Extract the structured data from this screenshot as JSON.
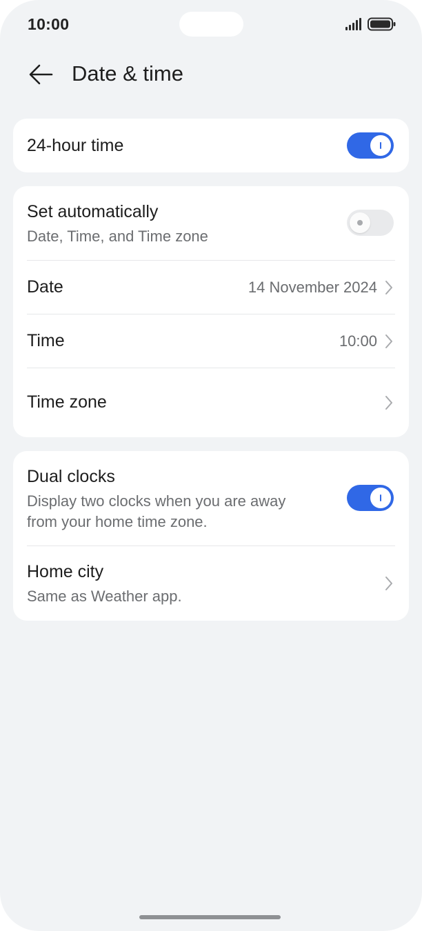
{
  "status_bar": {
    "time": "10:00",
    "icons": [
      "signal-icon",
      "battery-icon"
    ]
  },
  "header": {
    "title": "Date & time",
    "back_icon": "back-arrow-icon"
  },
  "settings": {
    "hour24": {
      "label": "24-hour time",
      "enabled": true
    },
    "auto": {
      "label": "Set automatically",
      "subtitle": "Date, Time, and Time zone",
      "enabled": false
    },
    "date": {
      "label": "Date",
      "value": "14 November 2024"
    },
    "time": {
      "label": "Time",
      "value": "10:00"
    },
    "timezone": {
      "label": "Time zone"
    },
    "dual_clocks": {
      "label": "Dual clocks",
      "subtitle_line1": "Display two clocks when you are away",
      "subtitle_line2": "from your home time zone.",
      "enabled": true
    },
    "home_city": {
      "label": "Home city",
      "subtitle": "Same as Weather app."
    }
  },
  "colors": {
    "accent": "#3068e6",
    "background": "#f1f3f5",
    "card": "#ffffff",
    "secondary_text": "#6b6d70"
  }
}
